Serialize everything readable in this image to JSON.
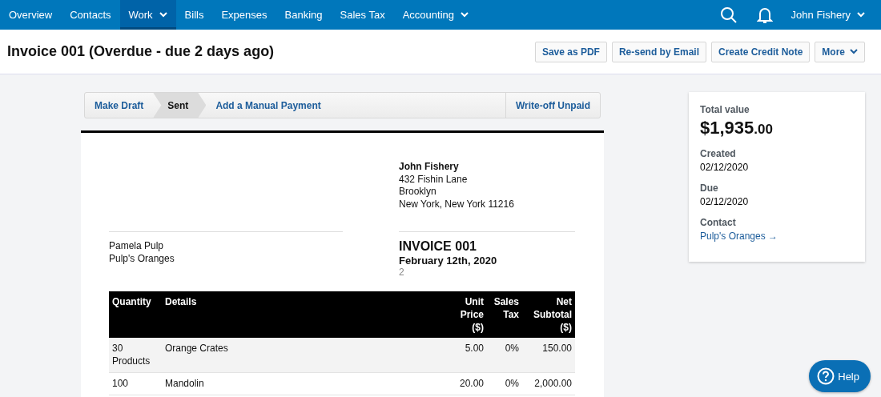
{
  "nav": {
    "items": [
      {
        "label": "Overview",
        "selected": false,
        "dropdown": false
      },
      {
        "label": "Contacts",
        "selected": false,
        "dropdown": false
      },
      {
        "label": "Work",
        "selected": true,
        "dropdown": true
      },
      {
        "label": "Bills",
        "selected": false,
        "dropdown": false
      },
      {
        "label": "Expenses",
        "selected": false,
        "dropdown": false
      },
      {
        "label": "Banking",
        "selected": false,
        "dropdown": false
      },
      {
        "label": "Sales Tax",
        "selected": false,
        "dropdown": false
      },
      {
        "label": "Accounting",
        "selected": false,
        "dropdown": true
      }
    ],
    "user": "John Fishery"
  },
  "header": {
    "title": "Invoice 001 (Overdue - due 2 days ago)",
    "actions": [
      {
        "label": "Save as PDF",
        "dropdown": false
      },
      {
        "label": "Re-send by Email",
        "dropdown": false
      },
      {
        "label": "Create Credit Note",
        "dropdown": false
      },
      {
        "label": "More",
        "dropdown": true
      }
    ]
  },
  "workflow": {
    "steps": [
      {
        "label": "Make Draft",
        "selected": false
      },
      {
        "label": "Sent",
        "selected": true
      },
      {
        "label": "Add a Manual Payment",
        "selected": false
      }
    ],
    "side_action": "Write-off Unpaid"
  },
  "invoice": {
    "from": {
      "name": "John Fishery",
      "lines": [
        "432 Fishin Lane",
        "Brooklyn",
        "New York, New York 11216"
      ]
    },
    "to": [
      "Pamela Pulp",
      "Pulp's Oranges"
    ],
    "title": "INVOICE 001",
    "date": "February 12th, 2020",
    "reference": "2",
    "table": {
      "columns": [
        "Quantity",
        "Details",
        "Unit Price ($)",
        "Sales Tax",
        "Net Subtotal ($)"
      ],
      "rows": [
        [
          "30 Products",
          "Orange Crates",
          "5.00",
          "0%",
          "150.00"
        ],
        [
          "100",
          "Mandolin",
          "20.00",
          "0%",
          "2,000.00"
        ]
      ]
    }
  },
  "summary": {
    "total_label": "Total value",
    "total_main": "$1,935",
    "total_cents": ".00",
    "fields": [
      {
        "label": "Created",
        "value": "02/12/2020",
        "kind": "text"
      },
      {
        "label": "Due",
        "value": "02/12/2020",
        "kind": "text"
      },
      {
        "label": "Contact",
        "value": "Pulp's Oranges →",
        "kind": "link"
      }
    ]
  },
  "help": "Help"
}
